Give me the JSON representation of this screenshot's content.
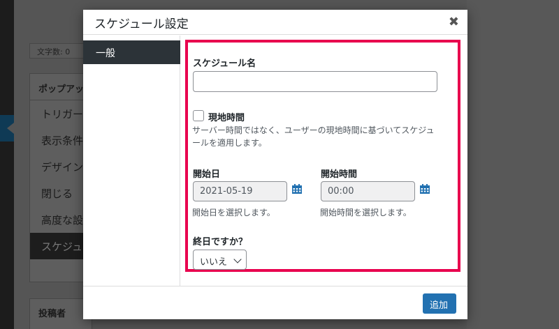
{
  "background": {
    "word_count": "文字数: 0",
    "popup_box_title": "ポップアッ",
    "menu_items": [
      "トリガー",
      "表示条件",
      "デザイン",
      "閉じる",
      "高度な設",
      "スケジュ"
    ],
    "author_box_title": "投稿者"
  },
  "modal": {
    "title": "スケジュール設定",
    "close_glyph": "✖",
    "tab_general": "一般",
    "schedule_name_label": "スケジュール名",
    "schedule_name_value": "",
    "local_time_label": "現地時間",
    "local_time_checked": false,
    "local_time_desc_line1": "サーバー時間ではなく、ユーザーの現地時間に基づいてスケジュ",
    "local_time_desc_line2": "ールを適用します。",
    "start_date_label": "開始日",
    "start_date_value": "2021-05-19",
    "start_date_desc": "開始日を選択します。",
    "start_time_label": "開始時間",
    "start_time_value": "00:00",
    "start_time_desc": "開始時間を選択します。",
    "all_day_label": "終日ですか？",
    "all_day_value": "いいえ",
    "add_button": "追加"
  },
  "colors": {
    "highlight": "#e8004e",
    "primary": "#2271b1",
    "tab_active": "#2c3338"
  }
}
